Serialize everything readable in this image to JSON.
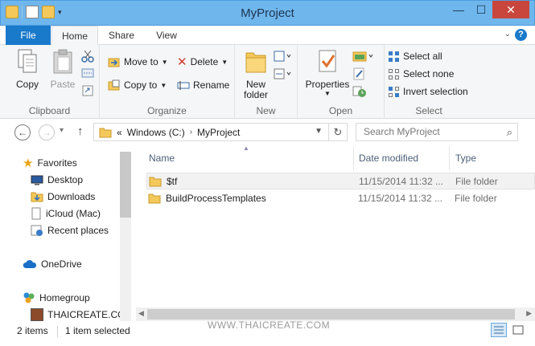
{
  "window": {
    "title": "MyProject",
    "buttons": {
      "minimize": "—",
      "maximize": "☐",
      "close": "✕"
    }
  },
  "ribbon_tabs": {
    "file": "File",
    "home": "Home",
    "share": "Share",
    "view": "View"
  },
  "ribbon": {
    "clipboard": {
      "label": "Clipboard",
      "copy": "Copy",
      "paste": "Paste"
    },
    "organize": {
      "label": "Organize",
      "move_to": "Move to",
      "copy_to": "Copy to",
      "delete": "Delete",
      "rename": "Rename"
    },
    "new": {
      "label": "New",
      "new_folder_line1": "New",
      "new_folder_line2": "folder"
    },
    "open": {
      "label": "Open",
      "properties": "Properties"
    },
    "select": {
      "label": "Select",
      "select_all": "Select all",
      "select_none": "Select none",
      "invert_selection": "Invert selection"
    }
  },
  "address": {
    "prefix": "«",
    "crumbs": [
      "Windows (C:)",
      "MyProject"
    ],
    "search_placeholder": "Search MyProject"
  },
  "nav_pane": {
    "favorites": "Favorites",
    "items": [
      "Desktop",
      "Downloads",
      "iCloud (Mac)",
      "Recent places"
    ],
    "onedrive": "OneDrive",
    "homegroup": "Homegroup",
    "homegroup_user": "THAICREATE.CO"
  },
  "columns": {
    "name": "Name",
    "date_modified": "Date modified",
    "type": "Type"
  },
  "files": [
    {
      "name": "$tf",
      "date": "11/15/2014 11:32 ...",
      "type": "File folder",
      "selected": true
    },
    {
      "name": "BuildProcessTemplates",
      "date": "11/15/2014 11:32 ...",
      "type": "File folder",
      "selected": false
    }
  ],
  "status": {
    "count": "2 items",
    "selection": "1 item selected",
    "watermark": "WWW.THAICREATE.COM"
  },
  "colors": {
    "titlebar": "#6fb6ec",
    "file_tab": "#1979ca",
    "close": "#c9463d",
    "folder": "#f4c85a"
  }
}
